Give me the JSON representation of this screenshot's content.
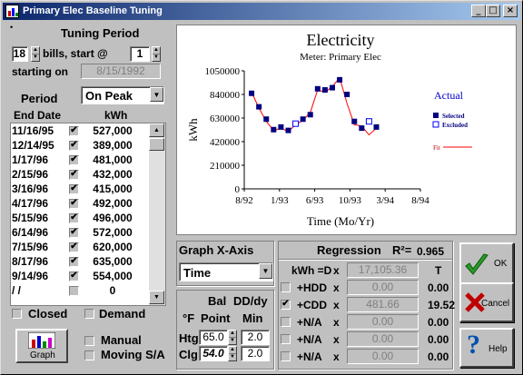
{
  "window": {
    "title": "Primary Elec Baseline Tuning",
    "controls": {
      "minimize": "_",
      "maximize": "□",
      "close": "×"
    }
  },
  "tuning": {
    "heading": "Tuning Period",
    "bills_count": "18",
    "bills_label": "bills, start @",
    "start_index": "1",
    "starting_on_label": "starting on",
    "start_date": "8/15/1992",
    "period_label": "Period",
    "period_value": "On Peak",
    "col_date": "End Date",
    "col_kwh": "kWh",
    "rows": [
      {
        "date": "11/16/95",
        "checked": true,
        "kwh": "527,000"
      },
      {
        "date": "12/14/95",
        "checked": true,
        "kwh": "389,000"
      },
      {
        "date": "1/17/96",
        "checked": true,
        "kwh": "481,000"
      },
      {
        "date": "2/15/96",
        "checked": true,
        "kwh": "432,000"
      },
      {
        "date": "3/16/96",
        "checked": true,
        "kwh": "415,000"
      },
      {
        "date": "4/17/96",
        "checked": true,
        "kwh": "492,000"
      },
      {
        "date": "5/15/96",
        "checked": true,
        "kwh": "496,000"
      },
      {
        "date": "6/14/96",
        "checked": true,
        "kwh": "572,000"
      },
      {
        "date": "7/15/96",
        "checked": true,
        "kwh": "620,000"
      },
      {
        "date": "8/17/96",
        "checked": true,
        "kwh": "635,000"
      },
      {
        "date": "9/14/96",
        "checked": true,
        "kwh": "554,000"
      },
      {
        "date": "/ /",
        "checked": false,
        "kwh": "0"
      }
    ],
    "closed_label": "Closed",
    "demand_label": "Demand"
  },
  "bottom_left": {
    "graph_button": "Graph",
    "manual_label": "Manual",
    "moving_label": "Moving S/A"
  },
  "chart_data": {
    "type": "line",
    "title": "Electricity",
    "subtitle": "Meter: Primary Elec",
    "xlabel": "Time (Mo/Yr)",
    "ylabel": "kWh",
    "x_ticks": [
      "8/92",
      "1/93",
      "6/93",
      "10/93",
      "3/94",
      "8/94"
    ],
    "y_ticks": [
      "0",
      "210000",
      "420000",
      "630000",
      "840000",
      "1050000"
    ],
    "ylim": [
      0,
      1050000
    ],
    "xlim": [
      0,
      24
    ],
    "legend": {
      "title": "Actual",
      "selected": "Selected",
      "excluded": "Excluded",
      "fit": "Fit",
      "placement": "right"
    },
    "colors": {
      "selected": "#000080",
      "excluded": "#0000ff",
      "fit": "#ff0000"
    },
    "selected_points": [
      {
        "x": 1,
        "y": 850000
      },
      {
        "x": 2,
        "y": 730000
      },
      {
        "x": 3,
        "y": 620000
      },
      {
        "x": 4,
        "y": 527000
      },
      {
        "x": 5,
        "y": 550000
      },
      {
        "x": 6,
        "y": 520000
      },
      {
        "x": 8,
        "y": 620000
      },
      {
        "x": 9,
        "y": 660000
      },
      {
        "x": 10,
        "y": 890000
      },
      {
        "x": 11,
        "y": 880000
      },
      {
        "x": 12,
        "y": 900000
      },
      {
        "x": 13,
        "y": 970000
      },
      {
        "x": 14,
        "y": 840000
      },
      {
        "x": 15,
        "y": 600000
      },
      {
        "x": 16,
        "y": 540000
      },
      {
        "x": 18,
        "y": 550000
      }
    ],
    "excluded_points": [
      {
        "x": 7,
        "y": 580000
      },
      {
        "x": 17,
        "y": 600000
      }
    ],
    "fit_line": [
      {
        "x": 1,
        "y": 860000
      },
      {
        "x": 2,
        "y": 720000
      },
      {
        "x": 3,
        "y": 600000
      },
      {
        "x": 4,
        "y": 520000
      },
      {
        "x": 5,
        "y": 540000
      },
      {
        "x": 6,
        "y": 510000
      },
      {
        "x": 7,
        "y": 570000
      },
      {
        "x": 8,
        "y": 610000
      },
      {
        "x": 9,
        "y": 680000
      },
      {
        "x": 10,
        "y": 880000
      },
      {
        "x": 11,
        "y": 860000
      },
      {
        "x": 12,
        "y": 910000
      },
      {
        "x": 13,
        "y": 990000
      },
      {
        "x": 14,
        "y": 760000
      },
      {
        "x": 15,
        "y": 570000
      },
      {
        "x": 16,
        "y": 560000
      },
      {
        "x": 17,
        "y": 480000
      },
      {
        "x": 18,
        "y": 540000
      }
    ]
  },
  "xaxis_panel": {
    "heading": "Graph X-Axis",
    "value": "Time"
  },
  "balance": {
    "h1a": "Bal",
    "h1b": "DD/dy",
    "h2a": "°F",
    "h2b": "Point",
    "h2c": "Min",
    "htg_label": "Htg",
    "htg_point": "65.0",
    "htg_min": "2.0",
    "clg_label": "Clg",
    "clg_point": "54.0",
    "clg_min": "2.0"
  },
  "regression": {
    "heading": "Regression",
    "r2_label": "R²=",
    "r2_value": "0.965",
    "rows": [
      {
        "checkbox": false,
        "label": "kWh =D",
        "x": "x",
        "value": "17,105.36",
        "t": "T"
      },
      {
        "checkbox": true,
        "has_box": true,
        "checked": false,
        "label": "+HDD",
        "x": "x",
        "value": "0.00",
        "t": "0.00"
      },
      {
        "checkbox": true,
        "has_box": true,
        "checked": true,
        "label": "+CDD",
        "x": "x",
        "value": "481.66",
        "t": "19.52"
      },
      {
        "checkbox": true,
        "has_box": true,
        "checked": false,
        "label": "+N/A",
        "x": "x",
        "value": "0.00",
        "t": "0.00"
      },
      {
        "checkbox": true,
        "has_box": true,
        "checked": false,
        "label": "+N/A",
        "x": "x",
        "value": "0.00",
        "t": "0.00"
      },
      {
        "checkbox": true,
        "has_box": true,
        "checked": false,
        "label": "+N/A",
        "x": "x",
        "value": "0.00",
        "t": "0.00"
      }
    ]
  },
  "buttons": {
    "ok": "OK",
    "cancel": "Cancel",
    "help": "Help"
  }
}
